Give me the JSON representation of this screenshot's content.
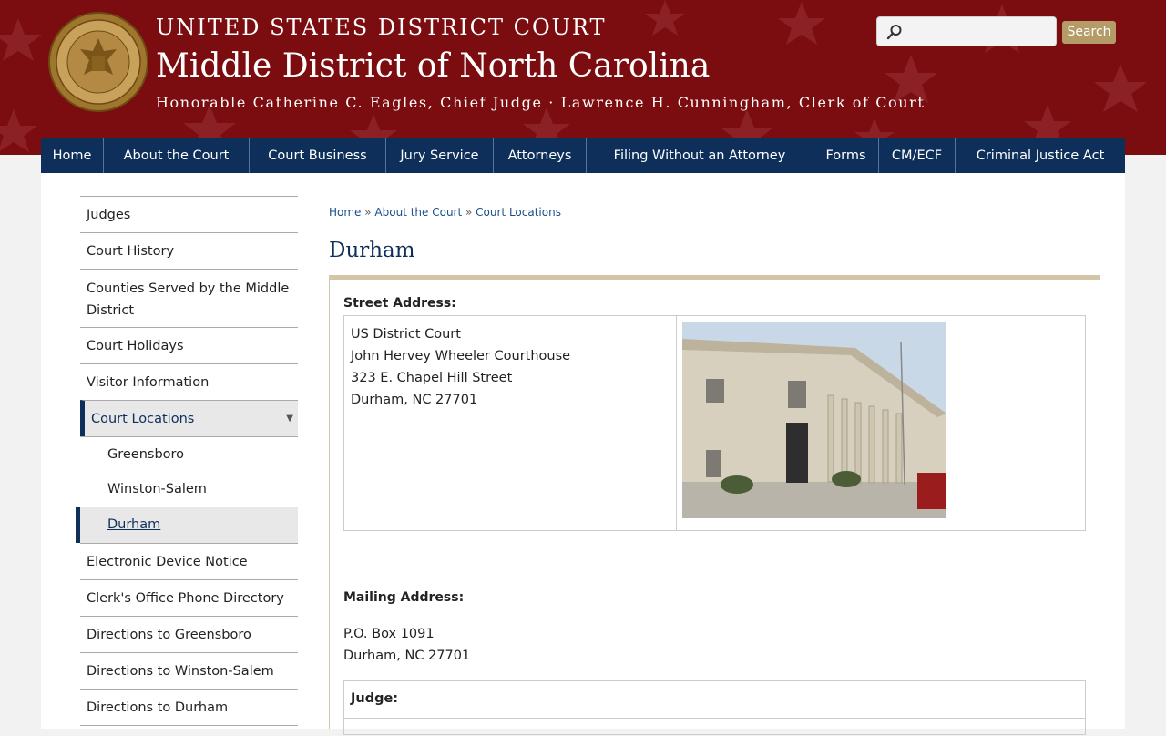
{
  "header": {
    "line1": "UNITED STATES DISTRICT COURT",
    "line2": "Middle District of North Carolina",
    "line3": "Honorable Catherine C. Eagles, Chief Judge · Lawrence H. Cunningham, Clerk of Court",
    "seal_text": "THE UNITED STATES DISTRICT COURT MIDDLE DISTRICT OF NORTH CAROLINA"
  },
  "search": {
    "placeholder": "",
    "value": "",
    "button_label": "Search"
  },
  "nav": [
    "Home",
    "About the Court",
    "Court Business",
    "Jury Service",
    "Attorneys",
    "Filing Without an Attorney",
    "Forms",
    "CM/ECF",
    "Criminal Justice Act"
  ],
  "sidebar": {
    "items": [
      "Judges",
      "Court History",
      "Counties Served by the Middle District",
      "Court Holidays",
      "Visitor Information",
      "Court Locations",
      "Greensboro",
      "Winston-Salem",
      "Durham",
      "Electronic Device Notice",
      "Clerk's Office Phone Directory",
      "Directions to Greensboro",
      "Directions to Winston-Salem",
      "Directions to Durham"
    ]
  },
  "breadcrumb": [
    "Home",
    "About the Court",
    "Court Locations"
  ],
  "page_title": "Durham",
  "street_label": "Street Address:",
  "street_address": [
    "US District Court",
    "John Hervey Wheeler Courthouse",
    "323 E. Chapel Hill Street",
    "Durham, NC 27701"
  ],
  "mailing_label": "Mailing Address:",
  "mailing_address": [
    "P.O. Box 1091",
    "Durham, NC 27701"
  ],
  "judge_label": "Judge:",
  "colors": {
    "header_bg": "#7b0d10",
    "nav_bg": "#0e2f5a",
    "accent_gold": "#b59b68",
    "title_blue": "#0e2f5a"
  }
}
